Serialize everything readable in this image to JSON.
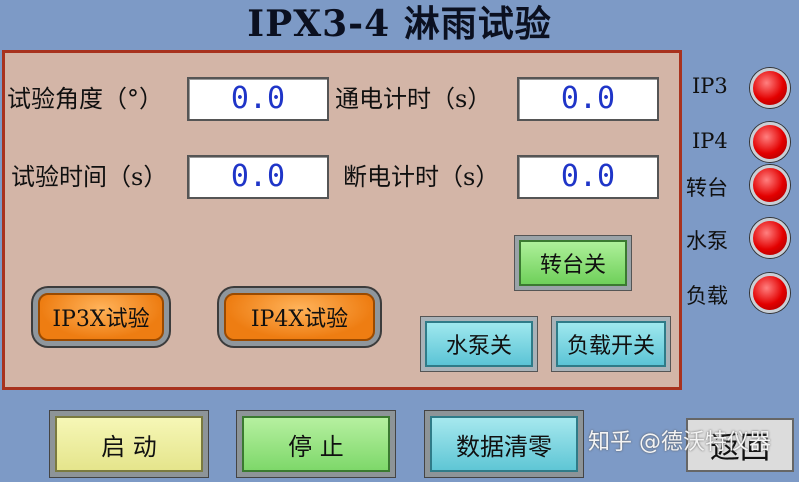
{
  "title": "IPX3-4 淋雨试验",
  "panel": {
    "fields": [
      {
        "label": "试验角度（°）",
        "value": "0.0"
      },
      {
        "label": "通电计时（s）",
        "value": "0.0"
      },
      {
        "label": "试验时间（s）",
        "value": "0.0"
      },
      {
        "label": "断电计时（s）",
        "value": "0.0"
      }
    ],
    "buttons": {
      "turntable_off": "转台关",
      "ip3x_test": "IP3X试验",
      "ip4x_test": "IP4X试验",
      "pump_off": "水泵关",
      "load_switch": "负载开关"
    }
  },
  "indicators": [
    {
      "label": "IP3",
      "color": "#e30000"
    },
    {
      "label": "IP4",
      "color": "#e30000"
    },
    {
      "label": "转台",
      "color": "#e30000"
    },
    {
      "label": "水泵",
      "color": "#e30000"
    },
    {
      "label": "负载",
      "color": "#e30000"
    }
  ],
  "bottom": {
    "start": "启 动",
    "stop": "停 止",
    "clear": "数据清零",
    "back": "返回"
  },
  "watermark": "知乎 @德沃特仪器",
  "colors": {
    "background": "#7d9ac6",
    "panel": "#d3b5a7",
    "panel_border": "#a8321e",
    "value_text": "#1f35c8"
  }
}
